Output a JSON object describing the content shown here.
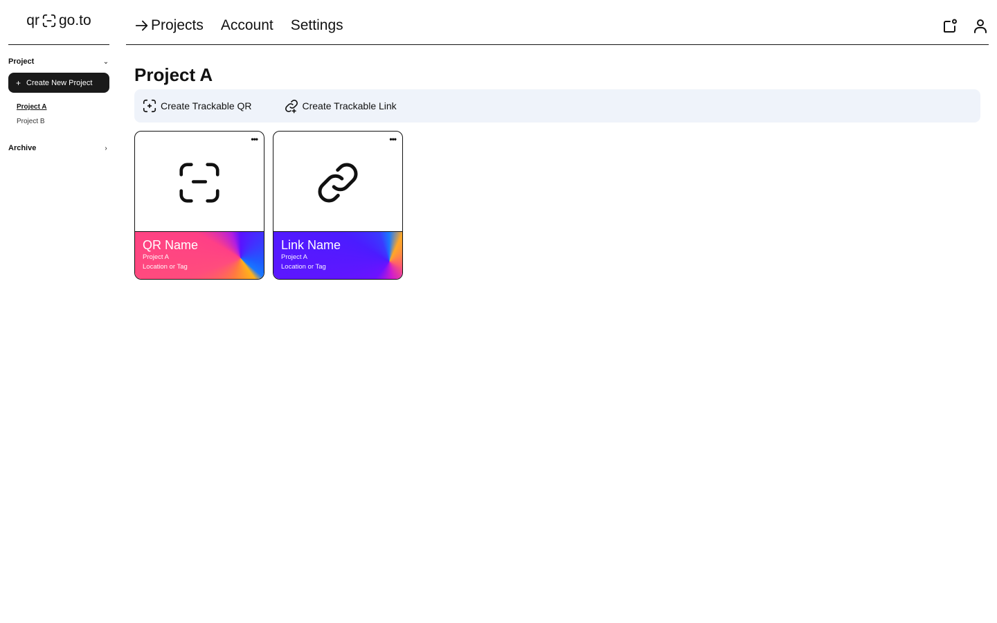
{
  "brand": {
    "left": "qr",
    "right": "go.to"
  },
  "sidebar": {
    "project_section": "Project",
    "create_button": "Create New Project",
    "projects": [
      {
        "label": "Project A",
        "active": true
      },
      {
        "label": "Project B",
        "active": false
      }
    ],
    "archive_section": "Archive"
  },
  "nav": {
    "items": [
      {
        "label": "Projects",
        "active": true
      },
      {
        "label": "Account",
        "active": false
      },
      {
        "label": "Settings",
        "active": false
      }
    ],
    "icons": [
      "notifications-icon",
      "user-icon"
    ]
  },
  "main": {
    "title": "Project A",
    "toolbar": {
      "create_qr": "Create Trackable QR",
      "create_link": "Create Trackable Link"
    },
    "cards": [
      {
        "type": "qr",
        "name": "QR Name",
        "project": "Project A",
        "tag": "Location or Tag",
        "more": "•••"
      },
      {
        "type": "link",
        "name": "Link Name",
        "project": "Project A",
        "tag": "Location or Tag",
        "more": "•••"
      }
    ]
  }
}
